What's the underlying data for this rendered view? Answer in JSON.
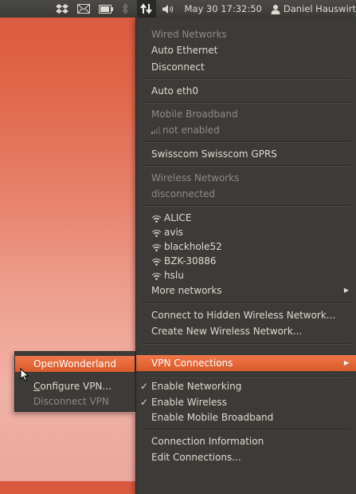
{
  "panel": {
    "indicators": [
      "dropbox-icon",
      "mail-icon",
      "battery-icon",
      "bluetooth-icon",
      "network-icon",
      "volume-icon"
    ],
    "datetime": "May 30 17:32:50",
    "user": "Daniel Hauswirt"
  },
  "network_menu": {
    "wired_header": "Wired Networks",
    "auto_ethernet": "Auto Ethernet",
    "disconnect": "Disconnect",
    "auto_eth0": "Auto eth0",
    "mobile_header": "Mobile Broadband",
    "mobile_status": "not enabled",
    "swisscom": "Swisscom Swisscom GPRS",
    "wireless_header": "Wireless Networks",
    "wireless_status": "disconnected",
    "networks": [
      "ALICE",
      "avis",
      "blackhole52",
      "BZK-30886",
      "hslu"
    ],
    "more_networks": "More networks",
    "connect_hidden": "Connect to Hidden Wireless Network...",
    "create_new": "Create New Wireless Network...",
    "vpn_connections": "VPN Connections",
    "enable_networking": "Enable Networking",
    "enable_wireless": "Enable Wireless",
    "enable_mobile": "Enable Mobile Broadband",
    "connection_info": "Connection Information",
    "edit_connections": "Edit Connections...",
    "accent": "#e8693a",
    "background": "#3c3b37"
  },
  "vpn_submenu": {
    "openwonderland": "OpenWonderland",
    "configure_prefix": "C",
    "configure_rest": "onfigure VPN...",
    "disconnect_vpn": "Disconnect VPN"
  }
}
